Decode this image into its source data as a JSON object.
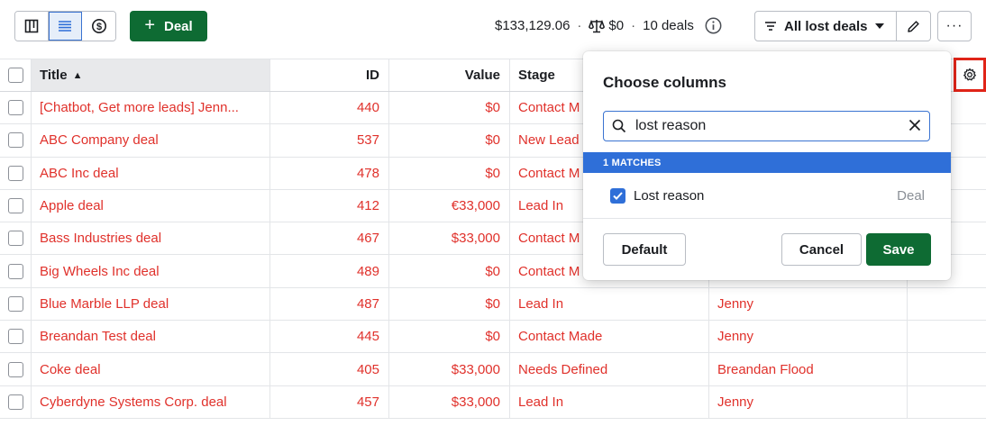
{
  "toolbar": {
    "deal_button_label": "Deal",
    "summary_total": "$133,129.06",
    "summary_weighted": "$0",
    "summary_count": "10 deals",
    "filter_label": "All lost deals",
    "more_label": "···"
  },
  "table": {
    "headers": {
      "title": "Title",
      "id": "ID",
      "value": "Value",
      "stage": "Stage"
    },
    "rows": [
      {
        "title": "[Chatbot, Get more leads] Jenn...",
        "id": "440",
        "value": "$0",
        "stage": "Contact M",
        "owner": ""
      },
      {
        "title": "ABC Company deal",
        "id": "537",
        "value": "$0",
        "stage": "New Lead",
        "owner": ""
      },
      {
        "title": "ABC Inc deal",
        "id": "478",
        "value": "$0",
        "stage": "Contact M",
        "owner": ""
      },
      {
        "title": "Apple deal",
        "id": "412",
        "value": "€33,000",
        "stage": "Lead In",
        "owner": ""
      },
      {
        "title": "Bass Industries deal",
        "id": "467",
        "value": "$33,000",
        "stage": "Contact M",
        "owner": ""
      },
      {
        "title": "Big Wheels Inc deal",
        "id": "489",
        "value": "$0",
        "stage": "Contact M",
        "owner": ""
      },
      {
        "title": "Blue Marble LLP deal",
        "id": "487",
        "value": "$0",
        "stage": "Lead In",
        "owner": "Jenny"
      },
      {
        "title": "Breandan Test deal",
        "id": "445",
        "value": "$0",
        "stage": "Contact Made",
        "owner": "Jenny"
      },
      {
        "title": "Coke deal",
        "id": "405",
        "value": "$33,000",
        "stage": "Needs Defined",
        "owner": "Breandan Flood"
      },
      {
        "title": "Cyberdyne Systems Corp. deal",
        "id": "457",
        "value": "$33,000",
        "stage": "Lead In",
        "owner": "Jenny"
      }
    ]
  },
  "popover": {
    "title": "Choose columns",
    "search_value": "lost reason",
    "matches_label": "1 MATCHES",
    "match_label": "Lost reason",
    "match_group": "Deal",
    "default_label": "Default",
    "cancel_label": "Cancel",
    "save_label": "Save"
  },
  "colors": {
    "brand_green": "#0e6b33",
    "link_red": "#e0312b",
    "accent_blue": "#2f6fd8",
    "highlight_red": "#e02418"
  }
}
